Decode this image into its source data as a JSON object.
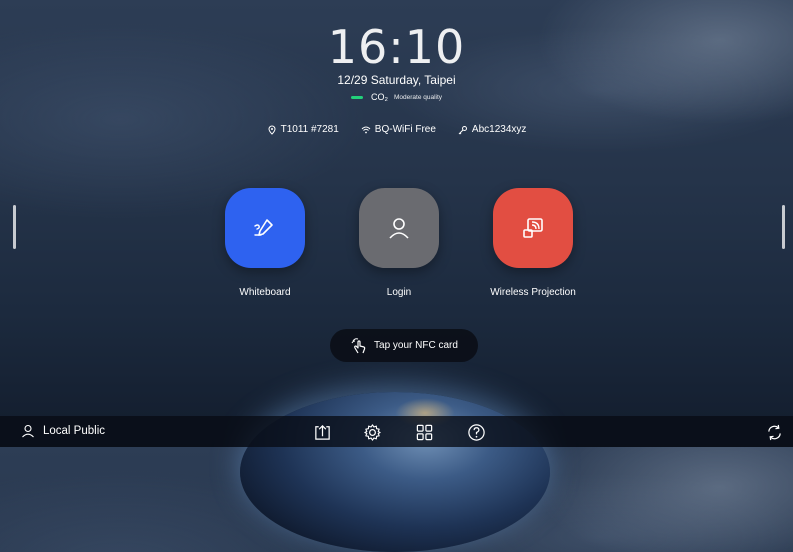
{
  "clock": {
    "time": "16:10",
    "date": "12/29 Saturday, Taipei"
  },
  "co2": {
    "label": "CO₂",
    "status": "Moderate quality",
    "indicator_color": "#22d07a"
  },
  "info": {
    "room": "T1011 #7281",
    "wifi": "BQ-WiFi Free",
    "password": "Abc1234xyz"
  },
  "apps": [
    {
      "label": "Whiteboard",
      "color": "#2e62f0",
      "icon": "pen-icon"
    },
    {
      "label": "Login",
      "color": "#6a6b70",
      "icon": "user-icon"
    },
    {
      "label": "Wireless Projection",
      "color": "#e24e42",
      "icon": "cast-icon"
    }
  ],
  "nfc": {
    "label": "Tap your NFC card"
  },
  "taskbar": {
    "user_label": "Local Public",
    "icons": [
      "upload-icon",
      "settings-gear-icon",
      "app-grid-icon",
      "help-icon",
      "refresh-icon"
    ]
  }
}
